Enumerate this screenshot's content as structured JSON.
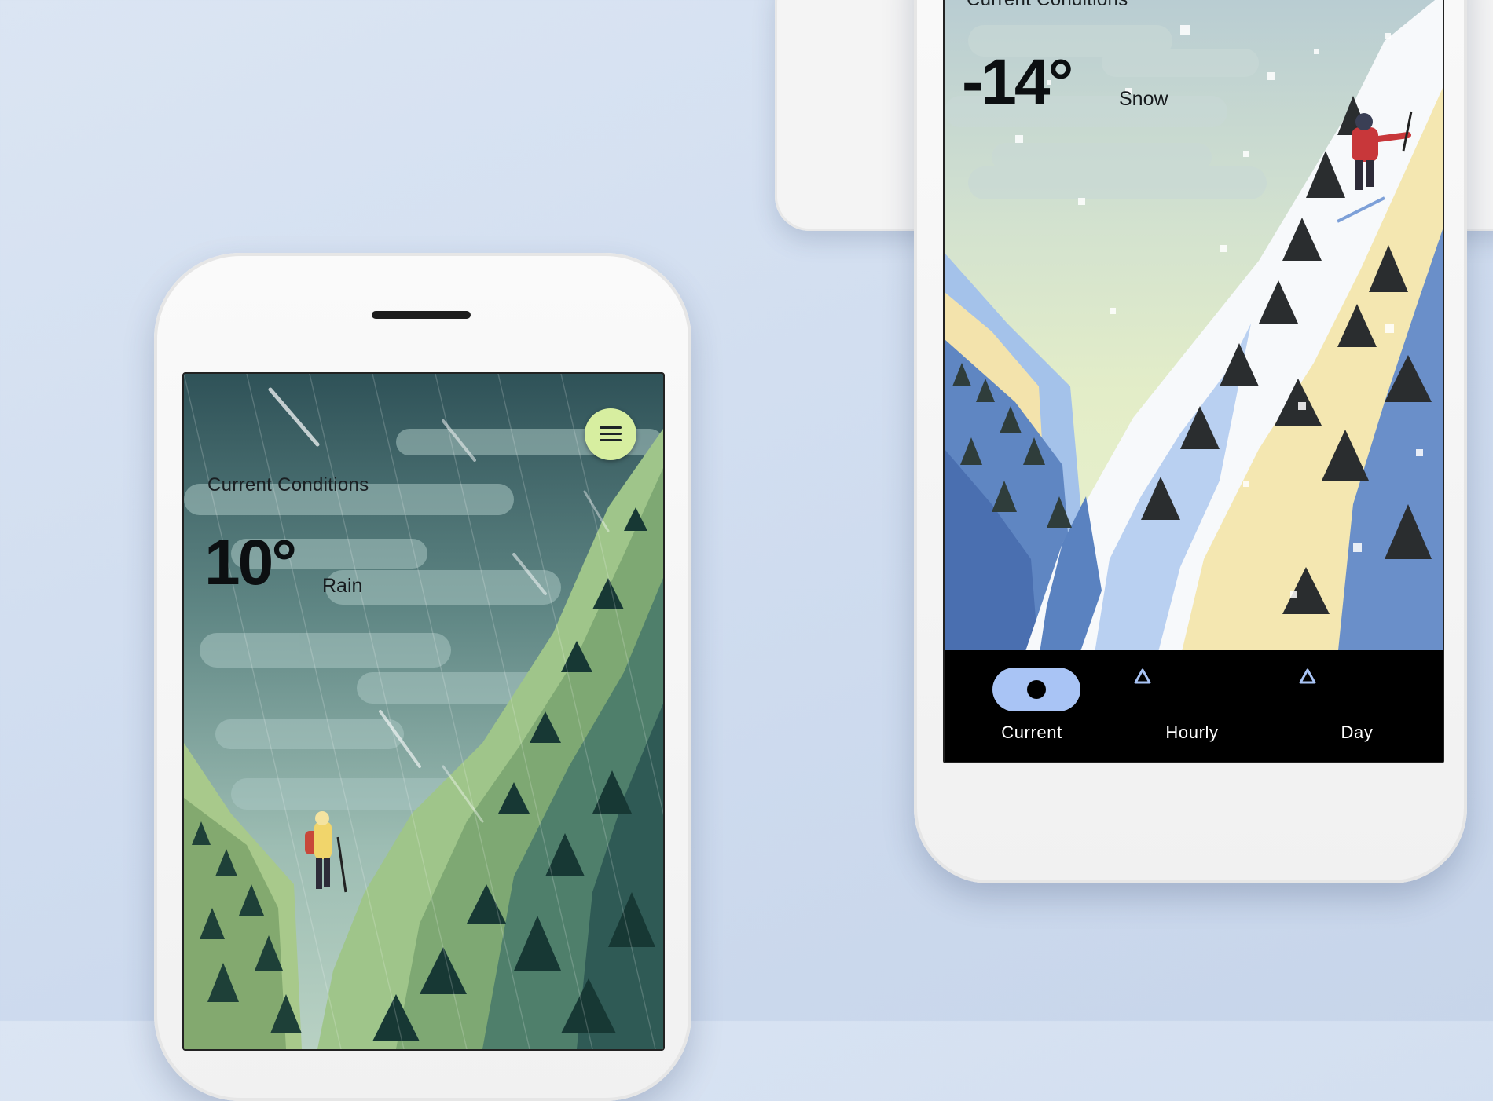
{
  "colors": {
    "background": "#d3dff0",
    "menu_button": "#d7eea0",
    "nav_active_pill": "#a9c4f5",
    "nav_background": "#000000"
  },
  "left_phone": {
    "conditions_label": "Current Conditions",
    "temperature": "10°",
    "condition": "Rain",
    "menu_icon": "hamburger-menu-icon"
  },
  "right_phone": {
    "conditions_label": "Current Conditions",
    "temperature": "-14°",
    "condition": "Snow",
    "nav": [
      {
        "label": "Current",
        "icon": "filled-circle-icon",
        "active": true
      },
      {
        "label": "Hourly",
        "icon": "triangle-outline-icon",
        "active": false
      },
      {
        "label": "Day",
        "icon": "triangle-outline-icon",
        "active": false
      }
    ]
  }
}
